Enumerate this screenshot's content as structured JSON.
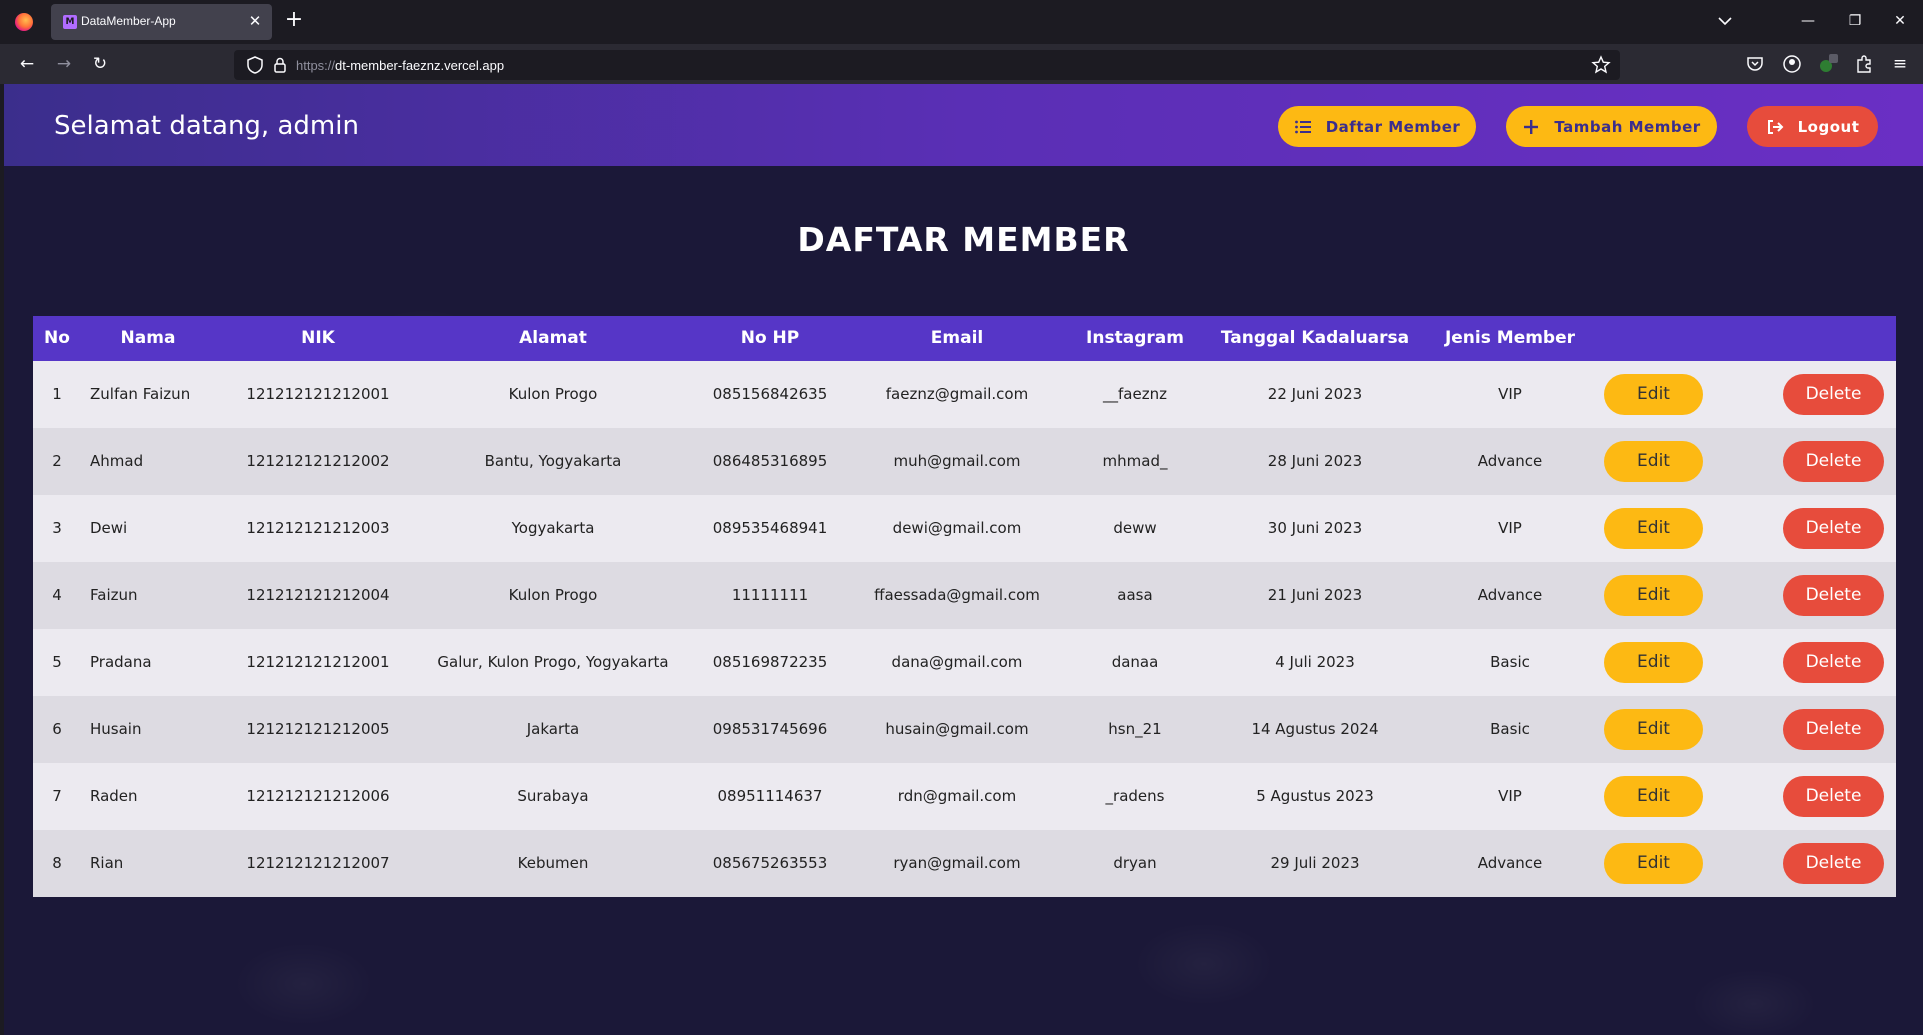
{
  "browser": {
    "tab_title": "DataMember-App",
    "url_proto": "https://",
    "url_host": "dt-member-faeznz.vercel.app"
  },
  "header": {
    "welcome": "Selamat datang, admin",
    "daftar_label": "Daftar Member",
    "tambah_label": "Tambah Member",
    "logout_label": "Logout"
  },
  "main": {
    "title": "DAFTAR MEMBER",
    "columns": [
      "No",
      "Nama",
      "NIK",
      "Alamat",
      "No HP",
      "Email",
      "Instagram",
      "Tanggal Kadaluarsa",
      "Jenis Member"
    ],
    "edit_label": "Edit",
    "delete_label": "Delete",
    "rows": [
      {
        "no": "1",
        "nama": "Zulfan Faizun",
        "nik": "121212121212001",
        "alamat": "Kulon Progo",
        "hp": "085156842635",
        "email": "faeznz@gmail.com",
        "ig": "__faeznz",
        "tgl": "22 Juni 2023",
        "jenis": "VIP"
      },
      {
        "no": "2",
        "nama": "Ahmad",
        "nik": "121212121212002",
        "alamat": "Bantu, Yogyakarta",
        "hp": "086485316895",
        "email": "muh@gmail.com",
        "ig": "mhmad_",
        "tgl": "28 Juni 2023",
        "jenis": "Advance"
      },
      {
        "no": "3",
        "nama": "Dewi",
        "nik": "121212121212003",
        "alamat": "Yogyakarta",
        "hp": "089535468941",
        "email": "dewi@gmail.com",
        "ig": "deww",
        "tgl": "30 Juni 2023",
        "jenis": "VIP"
      },
      {
        "no": "4",
        "nama": "Faizun",
        "nik": "121212121212004",
        "alamat": "Kulon Progo",
        "hp": "11111111",
        "email": "ffaessada@gmail.com",
        "ig": "aasa",
        "tgl": "21 Juni 2023",
        "jenis": "Advance"
      },
      {
        "no": "5",
        "nama": "Pradana",
        "nik": "121212121212001",
        "alamat": "Galur, Kulon Progo, Yogyakarta",
        "hp": "085169872235",
        "email": "dana@gmail.com",
        "ig": "danaa",
        "tgl": "4 Juli 2023",
        "jenis": "Basic"
      },
      {
        "no": "6",
        "nama": "Husain",
        "nik": "121212121212005",
        "alamat": "Jakarta",
        "hp": "098531745696",
        "email": "husain@gmail.com",
        "ig": "hsn_21",
        "tgl": "14 Agustus 2024",
        "jenis": "Basic"
      },
      {
        "no": "7",
        "nama": "Raden",
        "nik": "121212121212006",
        "alamat": "Surabaya",
        "hp": "08951114637",
        "email": "rdn@gmail.com",
        "ig": "_radens",
        "tgl": "5 Agustus 2023",
        "jenis": "VIP"
      },
      {
        "no": "8",
        "nama": "Rian",
        "nik": "121212121212007",
        "alamat": "Kebumen",
        "hp": "085675263553",
        "email": "ryan@gmail.com",
        "ig": "dryan",
        "tgl": "29 Juli 2023",
        "jenis": "Advance"
      }
    ]
  },
  "colors": {
    "accent_yellow": "#fdb913",
    "danger_red": "#e74c3c",
    "table_header": "#5636c7",
    "header_gradient_start": "#3b2e8c",
    "header_gradient_end": "#6a2fc4"
  }
}
